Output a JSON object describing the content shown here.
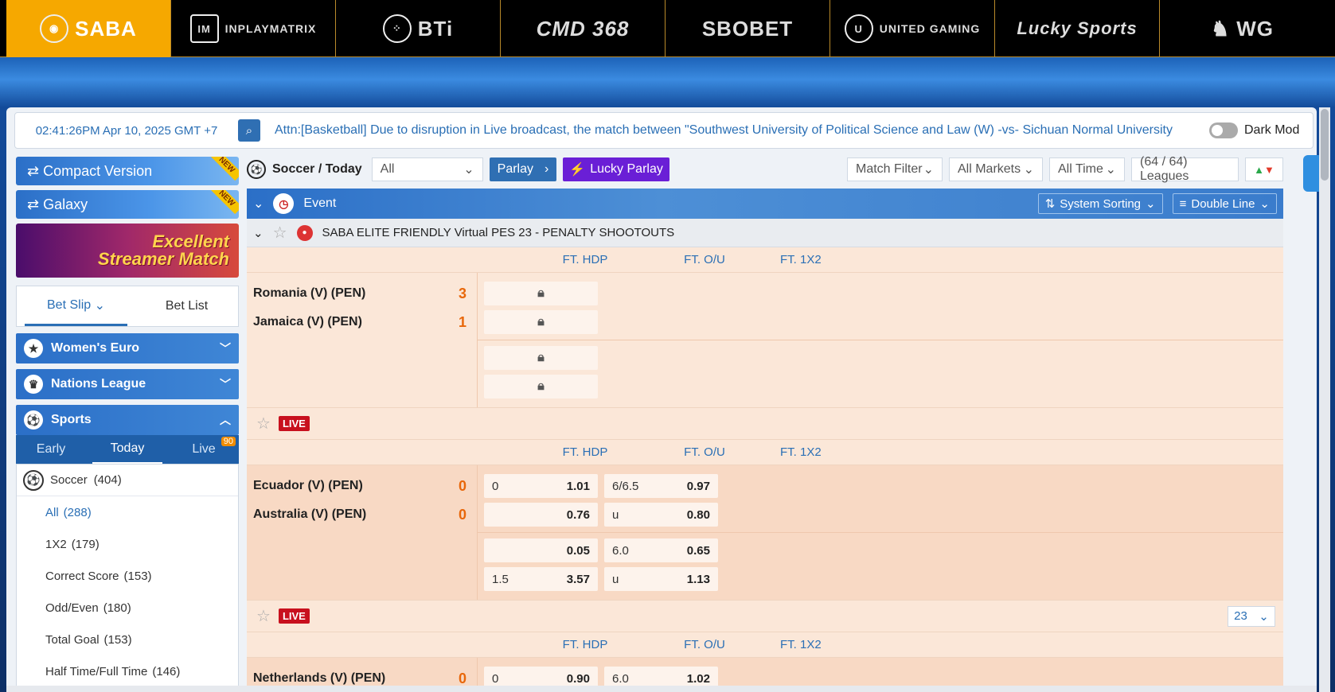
{
  "providers": [
    {
      "label": "SABA",
      "active": true
    },
    {
      "label": "INPLAYMATRIX"
    },
    {
      "label": "BTi"
    },
    {
      "label": "CMD 368"
    },
    {
      "label": "SBOBET"
    },
    {
      "label": "UNITED GAMING"
    },
    {
      "label": "Lucky Sports"
    },
    {
      "label": "WG"
    }
  ],
  "ticker": {
    "clock": "02:41:26PM Apr 10, 2025 GMT +7",
    "message": "Attn:[Basketball] Due to disruption in Live broadcast, the match between \"Southwest University of Political Science and Law (W) -vs- Sichuan Normal University",
    "dark_mode": "Dark Mod"
  },
  "sidebar": {
    "compact": "Compact Version",
    "galaxy": "Galaxy",
    "new_tag": "NEW",
    "banner_line1": "Excellent",
    "banner_line2": "Streamer Match",
    "bet_slip": "Bet Slip",
    "bet_list": "Bet List",
    "womens_euro": "Women's Euro",
    "nations_league": "Nations League",
    "sports": "Sports",
    "tabs": {
      "early": "Early",
      "today": "Today",
      "live": "Live",
      "live_count": "90"
    },
    "soccer": "Soccer",
    "soccer_count": "(404)",
    "items": [
      {
        "label": "All",
        "count": "(288)"
      },
      {
        "label": "1X2",
        "count": "(179)"
      },
      {
        "label": "Correct Score",
        "count": "(153)"
      },
      {
        "label": "Odd/Even",
        "count": "(180)"
      },
      {
        "label": "Total Goal",
        "count": "(153)"
      },
      {
        "label": "Half Time/Full Time",
        "count": "(146)"
      }
    ]
  },
  "toolbar": {
    "crumb": "Soccer / Today",
    "filter": "All",
    "parlay": "Parlay",
    "lucky": "Lucky Parlay",
    "match_filter": "Match Filter",
    "markets": "All Markets",
    "time": "All Time",
    "leagues": "(64 / 64) Leagues"
  },
  "eventbar": {
    "event": "Event",
    "sorting": "System Sorting",
    "line": "Double Line"
  },
  "league": "SABA ELITE FRIENDLY Virtual PES 23 - PENALTY SHOOTOUTS",
  "cols": {
    "hdp": "FT. HDP",
    "ou": "FT. O/U",
    "x12": "FT. 1X2"
  },
  "live": "LIVE",
  "count_select": "23",
  "m1": {
    "home": "Romania (V) (PEN)",
    "away": "Jamaica (V) (PEN)",
    "hs": "3",
    "as": "1"
  },
  "m2": {
    "home": "Ecuador (V) (PEN)",
    "away": "Australia (V) (PEN)",
    "hs": "0",
    "as": "0",
    "r1": {
      "h1": "0",
      "o1": "1.01",
      "h2": "6/6.5",
      "o2": "0.97"
    },
    "r2": {
      "h1": "",
      "o1": "0.76",
      "h2": "u",
      "o2": "0.80"
    },
    "r3": {
      "h1": "",
      "o1": "0.05",
      "h2": "6.0",
      "o2": "0.65"
    },
    "r4": {
      "h1": "1.5",
      "o1": "3.57",
      "h2": "u",
      "o2": "1.13"
    }
  },
  "m3": {
    "home": "Netherlands (V) (PEN)",
    "hs": "0",
    "r1": {
      "h1": "0",
      "o1": "0.90",
      "h2": "6.0",
      "o2": "1.02"
    }
  }
}
